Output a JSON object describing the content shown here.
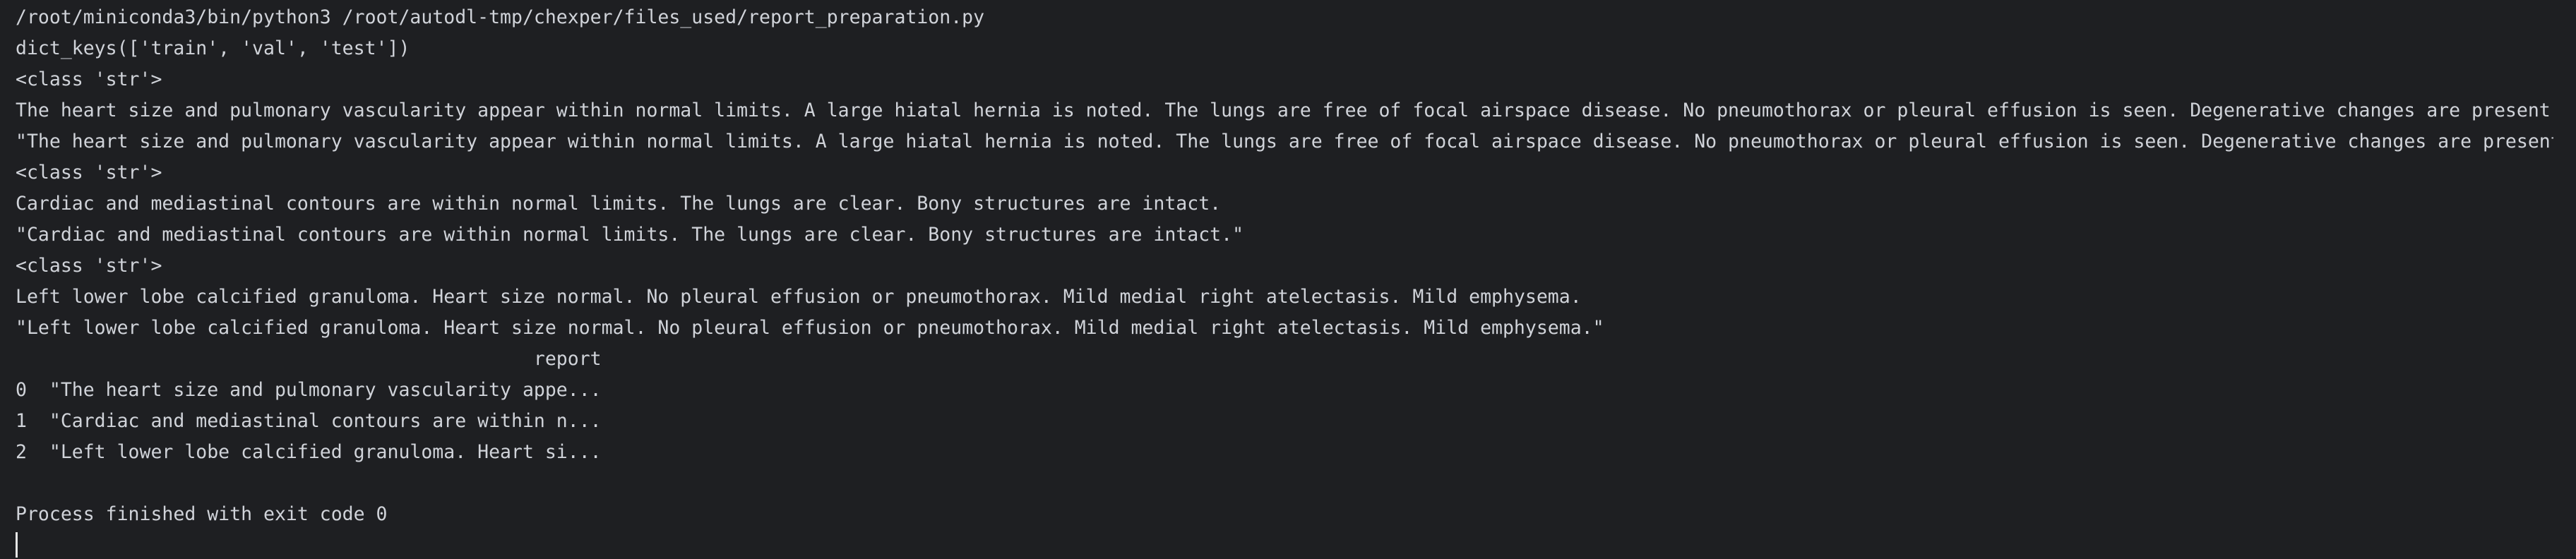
{
  "console": {
    "lines": [
      "/root/miniconda3/bin/python3 /root/autodl-tmp/chexper/files_used/report_preparation.py",
      "dict_keys(['train', 'val', 'test'])",
      "<class 'str'>",
      "The heart size and pulmonary vascularity appear within normal limits. A large hiatal hernia is noted. The lungs are free of focal airspace disease. No pneumothorax or pleural effusion is seen. Degenerative changes are present in t",
      "\"The heart size and pulmonary vascularity appear within normal limits. A large hiatal hernia is noted. The lungs are free of focal airspace disease. No pneumothorax or pleural effusion is seen. Degenerative changes are present in",
      "<class 'str'>",
      "Cardiac and mediastinal contours are within normal limits. The lungs are clear. Bony structures are intact.",
      "\"Cardiac and mediastinal contours are within normal limits. The lungs are clear. Bony structures are intact.\"",
      "<class 'str'>",
      "Left lower lobe calcified granuloma. Heart size normal. No pleural effusion or pneumothorax. Mild medial right atelectasis. Mild emphysema.",
      "\"Left lower lobe calcified granuloma. Heart size normal. No pleural effusion or pneumothorax. Mild medial right atelectasis. Mild emphysema.\"",
      "                                              report",
      "0  \"The heart size and pulmonary vascularity appe...",
      "1  \"Cardiac and mediastinal contours are within n...",
      "2  \"Left lower lobe calcified granuloma. Heart si...",
      "",
      "Process finished with exit code 0"
    ]
  }
}
